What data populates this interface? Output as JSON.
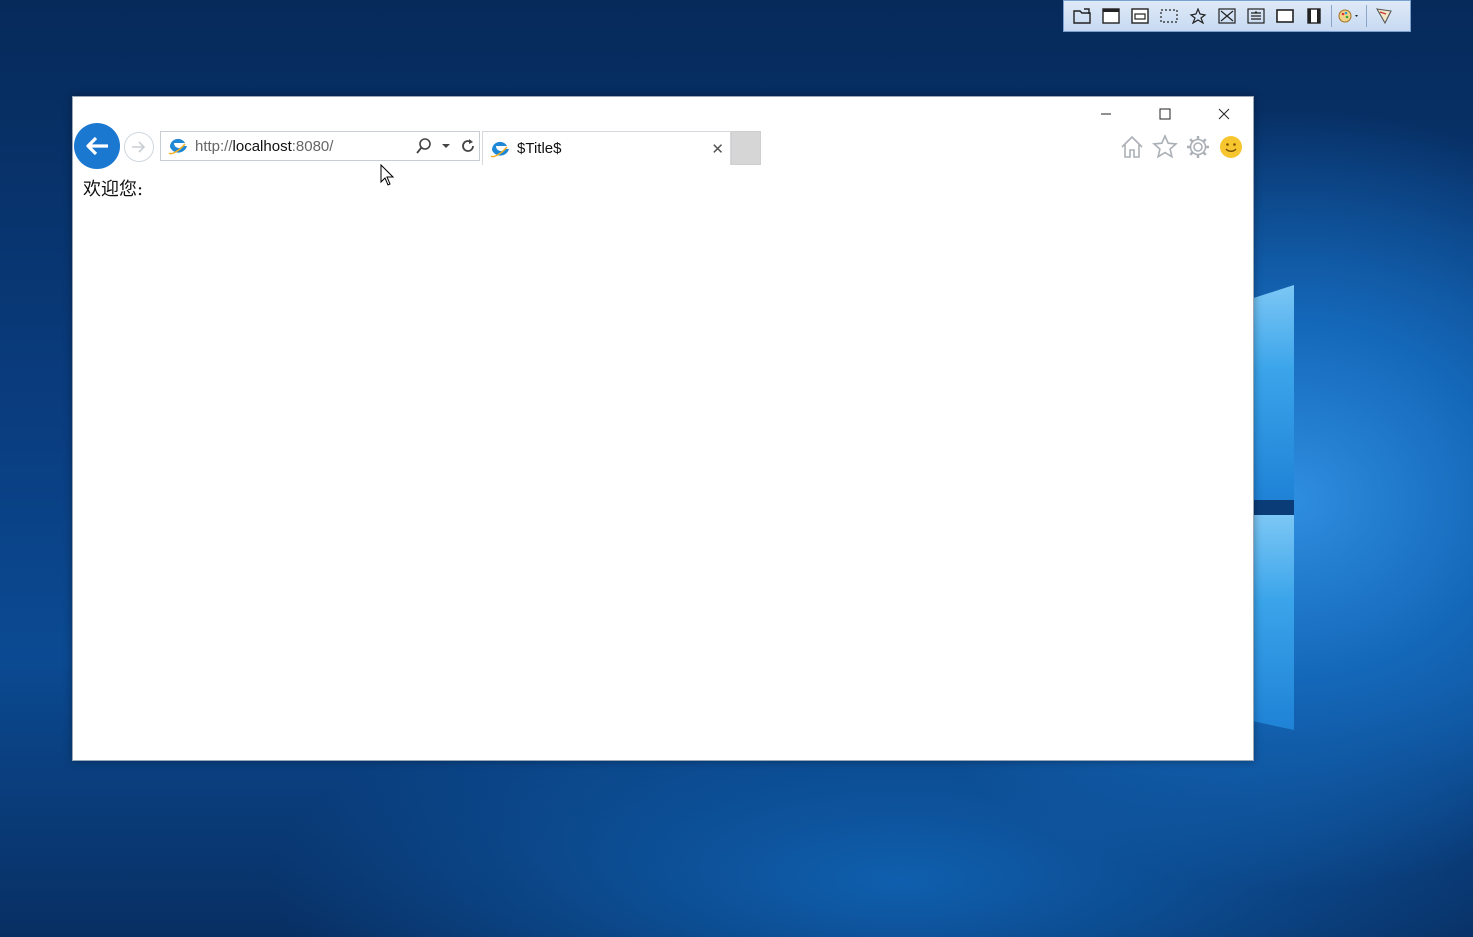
{
  "browser": {
    "url_scheme": "http://",
    "url_host": "localhost",
    "url_rest": ":8080/",
    "tab_title": "$Title$",
    "page_text": "欢迎您:",
    "caption": {
      "minimize": "—",
      "maximize": "☐",
      "close": "✕"
    }
  },
  "desktop": {
    "accent": "#1b78d0",
    "background": "#0a3d80"
  },
  "snip_toolbar": {
    "icons": [
      "open-icon",
      "window-capture-icon",
      "region-capture-icon",
      "rect-select-icon",
      "freeform-icon",
      "fullscreen-icon",
      "scroll-capture-icon",
      "screen-icon",
      "film-icon",
      "palette-icon",
      "pen-icon"
    ]
  }
}
